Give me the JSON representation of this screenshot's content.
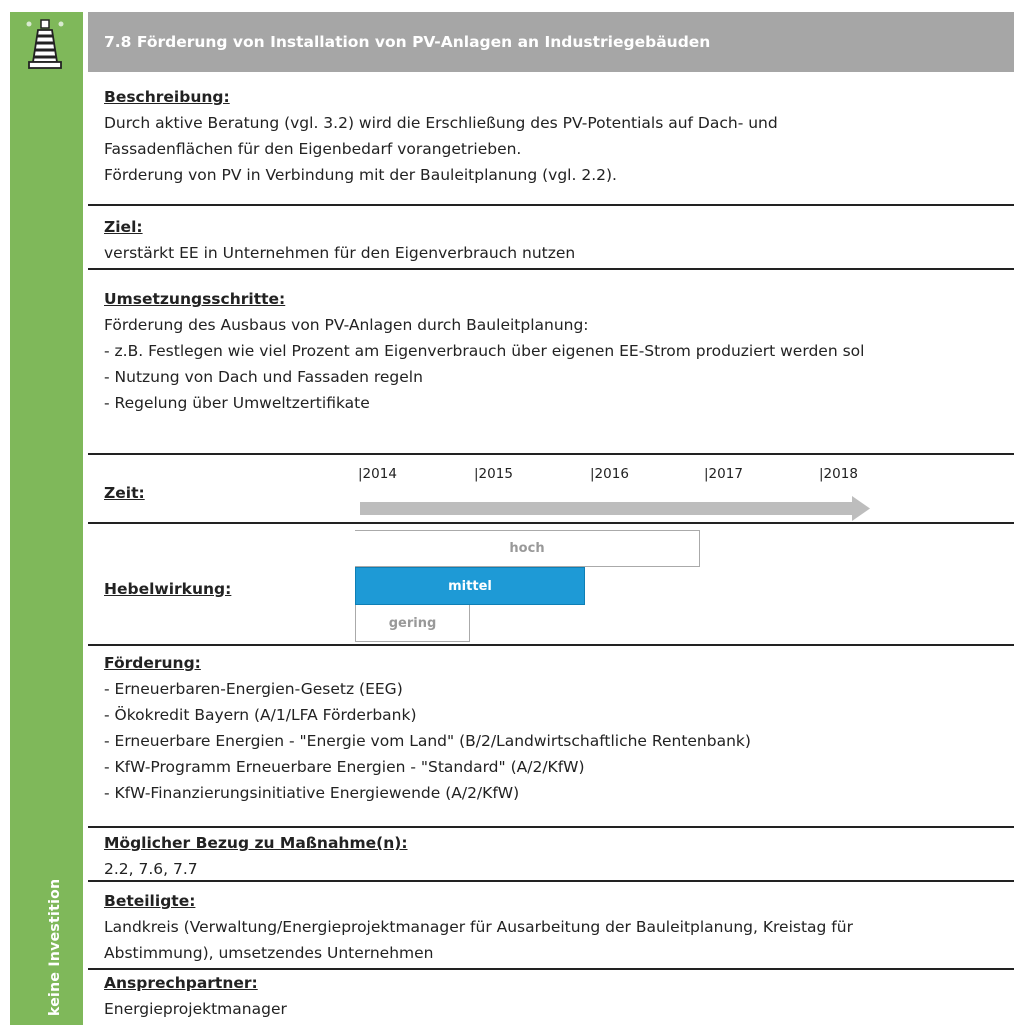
{
  "sidebar": {
    "icon": "lighthouse-icon",
    "label": "keine Investition",
    "color": "#7fb85a"
  },
  "title": "7.8 Förderung von Installation von PV-Anlagen an Industriegebäuden",
  "beschreibung": {
    "heading": "Beschreibung:",
    "lines": [
      "Durch aktive Beratung (vgl. 3.2) wird die Erschließung des PV-Potentials auf Dach- und",
      "Fassadenflächen für den Eigenbedarf vorangetrieben.",
      "Förderung von PV in Verbindung mit der Bauleitplanung (vgl. 2.2)."
    ]
  },
  "ziel": {
    "heading": "Ziel:",
    "lines": [
      "verstärkt EE in Unternehmen für den Eigenverbrauch nutzen"
    ]
  },
  "umsetzung": {
    "heading": "Umsetzungsschritte:",
    "lines": [
      "Förderung des Ausbaus von PV-Anlagen durch Bauleitplanung:",
      "- z.B. Festlegen wie viel Prozent am Eigenverbrauch über eigenen EE-Strom produziert werden sol",
      "- Nutzung von Dach und Fassaden regeln",
      "- Regelung über Umweltzertifikate"
    ]
  },
  "zeit": {
    "heading": "Zeit:",
    "years": [
      "|2014",
      "|2015",
      "|2016",
      "|2017",
      "|2018"
    ]
  },
  "hebel": {
    "heading": "Hebelwirkung:",
    "levels": [
      "hoch",
      "mittel",
      "gering"
    ],
    "selected": "mittel",
    "accent": "#1e9ad6"
  },
  "foerderung": {
    "heading": "Förderung:",
    "lines": [
      "- Erneuerbaren-Energien-Gesetz (EEG)",
      "- Ökokredit Bayern (A/1/LFA Förderbank)",
      "- Erneuerbare Energien - \"Energie vom Land\" (B/2/Landwirtschaftliche Rentenbank)",
      "- KfW-Programm Erneuerbare Energien - \"Standard\" (A/2/KfW)",
      "- KfW-Finanzierungsinitiative Energiewende (A/2/KfW)"
    ]
  },
  "bezug": {
    "heading": "Möglicher Bezug zu Maßnahme(n):",
    "lines": [
      "2.2, 7.6, 7.7"
    ]
  },
  "beteiligte": {
    "heading": "Beteiligte:",
    "lines": [
      "Landkreis (Verwaltung/Energieprojektmanager für Ausarbeitung der Bauleitplanung, Kreistag für",
      "Abstimmung), umsetzendes Unternehmen"
    ]
  },
  "ansprech": {
    "heading": "Ansprechpartner:",
    "lines": [
      "Energieprojektmanager"
    ]
  }
}
